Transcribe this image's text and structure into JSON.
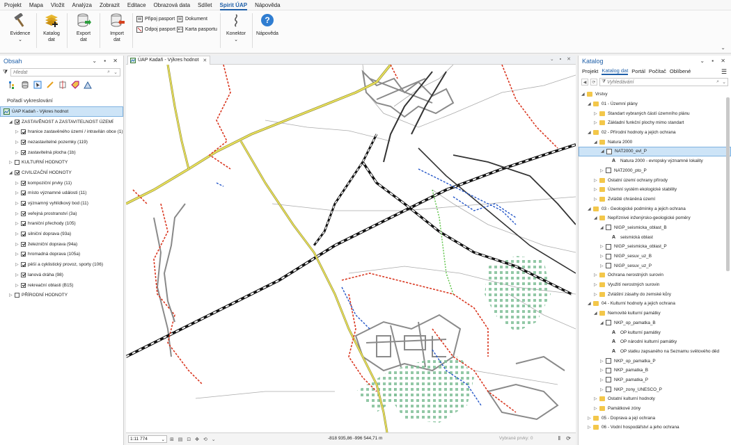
{
  "menubar": [
    "Projekt",
    "Mapa",
    "Vložit",
    "Analýza",
    "Zobrazit",
    "Editace",
    "Obrazová data",
    "Sdílet",
    "Spirit ÚAP",
    "Nápověda"
  ],
  "ribbon": {
    "evidence": "Evidence",
    "katalog_l1": "Katalog",
    "katalog_l2": "dat",
    "export_l1": "Export",
    "export_l2": "dat",
    "import_l1": "Import",
    "import_l2": "dat",
    "pripoj": "Připoj pasport",
    "odpoj": "Odpoj pasport",
    "dokument": "Dokument",
    "karta": "Karta pasportu",
    "konektor": "Konektor",
    "napoveda": "Nápověda"
  },
  "left": {
    "title": "Obsah",
    "search_placeholder": "Hledat",
    "section": "Pořadí vykreslování",
    "rows": [
      {
        "label": "ÚAP Kadaň - Výkres hodnot",
        "level": 0,
        "cb": false,
        "map": true,
        "sel": true
      },
      {
        "label": "ZASTAVĚNOST A ZASTAVITELNOST ÚZEMÍ",
        "level": 1,
        "cb": true,
        "tw": "◢"
      },
      {
        "label": "hranice zastavěného území / intravilán obce (1)",
        "level": 2,
        "cb": true,
        "tw": "▷"
      },
      {
        "label": "nezastavitelné pozemky (119)",
        "level": 2,
        "cb": true,
        "tw": "▷"
      },
      {
        "label": "zastavitelná plocha (1b)",
        "level": 2,
        "cb": true,
        "tw": "▷"
      },
      {
        "label": "KULTURNÍ HODNOTY",
        "level": 1,
        "cb": false,
        "tw": "▷"
      },
      {
        "label": "CIVILIZAČNÍ HODNOTY",
        "level": 1,
        "cb": true,
        "tw": "◢"
      },
      {
        "label": "kompoziční prvky (11)",
        "level": 2,
        "cb": true,
        "tw": "▷"
      },
      {
        "label": "místo významné události (11)",
        "level": 2,
        "cb": true,
        "tw": "▷"
      },
      {
        "label": "významný vyhlídkový bod (11)",
        "level": 2,
        "cb": true,
        "tw": "▷"
      },
      {
        "label": "veřejná prostranství (3a)",
        "level": 2,
        "cb": true,
        "tw": "▷"
      },
      {
        "label": "hraniční přechody (105)",
        "level": 2,
        "cb": true,
        "tw": "▷"
      },
      {
        "label": "silniční doprava (93a)",
        "level": 2,
        "cb": true,
        "tw": "▷"
      },
      {
        "label": "železniční doprava (94a)",
        "level": 2,
        "cb": true,
        "tw": "▷"
      },
      {
        "label": "hromadná doprava (105a)",
        "level": 2,
        "cb": true,
        "tw": "▷"
      },
      {
        "label": "pěší a cyklistický provoz, sporty (106)",
        "level": 2,
        "cb": true,
        "tw": "▷"
      },
      {
        "label": "lanová dráha (98)",
        "level": 2,
        "cb": true,
        "tw": "▷"
      },
      {
        "label": "rekreační oblasti (B15)",
        "level": 2,
        "cb": true,
        "tw": "▷"
      },
      {
        "label": "PŘÍRODNÍ HODNOTY",
        "level": 1,
        "cb": false,
        "tw": "▷"
      }
    ]
  },
  "map": {
    "tab_title": "ÚAP Kadaň - Výkres hodnot",
    "scale": "1:11 774",
    "coords": "-818 935,86 -996 544,71 m",
    "selected_features": "Vybrané prvky: 0"
  },
  "right": {
    "title": "Katalog",
    "tabs": [
      "Projekt",
      "Katalog dat",
      "Portál",
      "Počítač",
      "Oblíbené"
    ],
    "search_placeholder": "Vyhledávání",
    "rows": [
      {
        "label": "Vrstvy",
        "level": 0,
        "icon": "fold",
        "tw": "◢"
      },
      {
        "label": "01 - Územní plány",
        "level": 1,
        "icon": "fold",
        "tw": "◢"
      },
      {
        "label": "Standart vybraných částí územního plánu",
        "level": 2,
        "icon": "fold",
        "tw": "▷"
      },
      {
        "label": "Základní funkční plochy mimo standart",
        "level": 2,
        "icon": "fold",
        "tw": "▷"
      },
      {
        "label": "02 - Přírodní hodnoty a jejich ochrana",
        "level": 1,
        "icon": "fold",
        "tw": "◢"
      },
      {
        "label": "Natura 2000",
        "level": 2,
        "icon": "fold",
        "tw": "◢"
      },
      {
        "label": "NAT2000_evl_P",
        "level": 3,
        "icon": "lay",
        "tw": "◢",
        "sel": true
      },
      {
        "label": "Natura 2000 - evropsky významné lokality",
        "level": 4,
        "icon": "a",
        "tw": ""
      },
      {
        "label": "NAT2000_pto_P",
        "level": 3,
        "icon": "lay",
        "tw": "▷"
      },
      {
        "label": "Ostatní území ochrany přírody",
        "level": 2,
        "icon": "fold",
        "tw": "▷"
      },
      {
        "label": "Územní systém ekologické stability",
        "level": 2,
        "icon": "fold",
        "tw": "▷"
      },
      {
        "label": "Zvláště chráněná území",
        "level": 2,
        "icon": "fold",
        "tw": "▷"
      },
      {
        "label": "03 - Geologické podmínky a jejich ochrana",
        "level": 1,
        "icon": "fold",
        "tw": "◢"
      },
      {
        "label": "Nepříznivé inženýrsko-geologické poměry",
        "level": 2,
        "icon": "fold",
        "tw": "◢"
      },
      {
        "label": "NIGP_seismicka_oblast_B",
        "level": 3,
        "icon": "lay",
        "tw": "◢"
      },
      {
        "label": "seismická oblast",
        "level": 4,
        "icon": "a",
        "tw": ""
      },
      {
        "label": "NIGP_seismicka_oblast_P",
        "level": 3,
        "icon": "lay",
        "tw": "▷"
      },
      {
        "label": "NIGP_sesuv_uz_B",
        "level": 3,
        "icon": "lay",
        "tw": "▷"
      },
      {
        "label": "NIGP_sesuv_uz_P",
        "level": 3,
        "icon": "lay",
        "tw": "▷"
      },
      {
        "label": "Ochrana nerostných surovin",
        "level": 2,
        "icon": "fold",
        "tw": "▷"
      },
      {
        "label": "Využití nerostných surovin",
        "level": 2,
        "icon": "fold",
        "tw": "▷"
      },
      {
        "label": "Zvláštní zásahy do zemské kůry",
        "level": 2,
        "icon": "fold",
        "tw": "▷"
      },
      {
        "label": "04 - Kulturní hodnoty a jejich ochrana",
        "level": 1,
        "icon": "fold",
        "tw": "◢"
      },
      {
        "label": "Nemovité kulturní památky",
        "level": 2,
        "icon": "fold",
        "tw": "◢"
      },
      {
        "label": "NKP_op_pamatka_B",
        "level": 3,
        "icon": "lay",
        "tw": "◢"
      },
      {
        "label": "OP kulturní památky",
        "level": 4,
        "icon": "a",
        "tw": ""
      },
      {
        "label": "OP národní kulturní památky",
        "level": 4,
        "icon": "a",
        "tw": ""
      },
      {
        "label": "OP statku zapsaného na Seznamu světového děd",
        "level": 4,
        "icon": "a",
        "tw": ""
      },
      {
        "label": "NKP_op_pamatka_P",
        "level": 3,
        "icon": "lay",
        "tw": "▷"
      },
      {
        "label": "NKP_pamatka_B",
        "level": 3,
        "icon": "lay",
        "tw": "▷"
      },
      {
        "label": "NKP_pamatka_P",
        "level": 3,
        "icon": "lay",
        "tw": "▷"
      },
      {
        "label": "NKP_zony_UNESCO_P",
        "level": 3,
        "icon": "lay",
        "tw": "▷"
      },
      {
        "label": "Ostatní kulturní hodnoty",
        "level": 2,
        "icon": "fold",
        "tw": "▷"
      },
      {
        "label": "Památkové zóny",
        "level": 2,
        "icon": "fold",
        "tw": "▷"
      },
      {
        "label": "05 - Doprava a její ochrana",
        "level": 1,
        "icon": "fold",
        "tw": "▷"
      },
      {
        "label": "06 - Vodní hospodářství a jeho ochrana",
        "level": 1,
        "icon": "fold",
        "tw": "▷"
      }
    ]
  }
}
